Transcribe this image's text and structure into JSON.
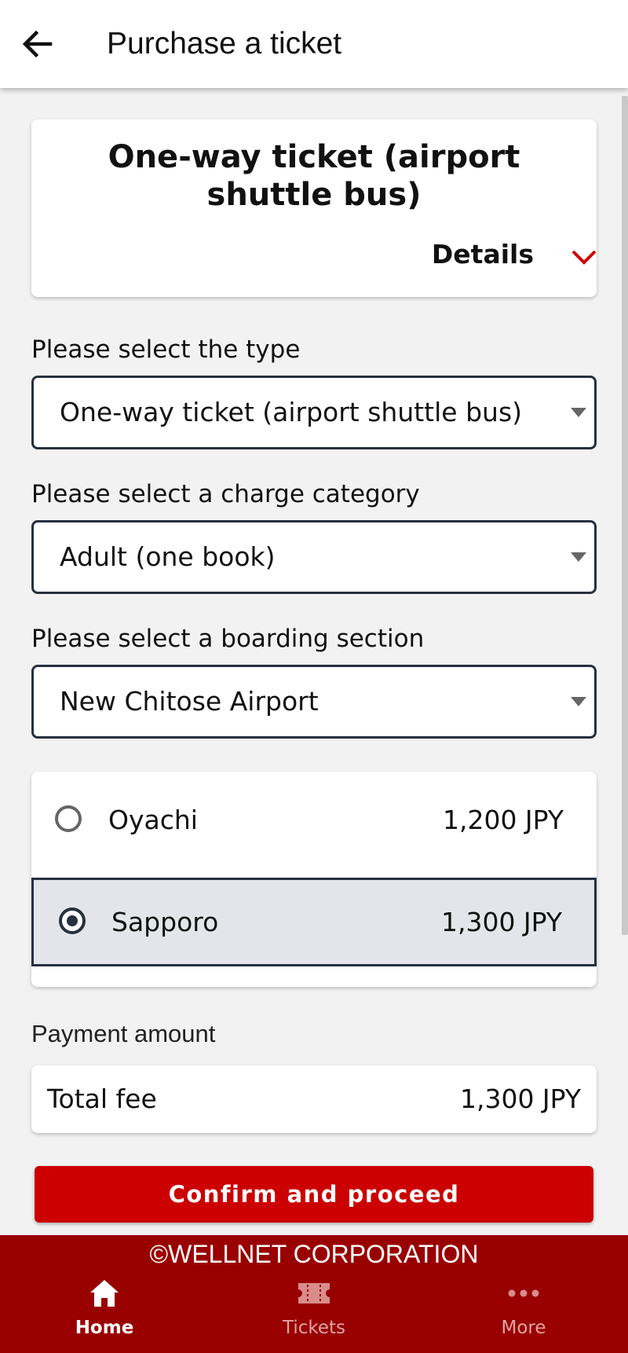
{
  "header": {
    "title": "Purchase a ticket",
    "back_icon": "arrow-left-icon"
  },
  "ticket_card": {
    "title": "One-way ticket (airport shuttle bus)",
    "details_label": "Details",
    "details_icon": "chevron-down-icon"
  },
  "form": {
    "type": {
      "label": "Please select the type",
      "selected": "One-way ticket (airport shuttle bus)"
    },
    "charge_category": {
      "label": "Please select a charge category",
      "selected": "Adult (one book)"
    },
    "boarding_section": {
      "label": "Please select a boarding section",
      "selected": "New Chitose Airport"
    }
  },
  "destinations": [
    {
      "name": "Oyachi",
      "price": "1,200 JPY",
      "selected": false
    },
    {
      "name": "Sapporo",
      "price": "1,300 JPY",
      "selected": true
    }
  ],
  "payment": {
    "section_label": "Payment amount",
    "total_label": "Total fee",
    "total_value": "1,300 JPY"
  },
  "confirm_label": "Confirm and proceed",
  "footer": {
    "copyright": "©WELLNET CORPORATION",
    "nav": [
      {
        "label": "Home",
        "icon": "home-icon",
        "active": true
      },
      {
        "label": "Tickets",
        "icon": "ticket-icon",
        "active": false
      },
      {
        "label": "More",
        "icon": "more-dots-icon",
        "active": false
      }
    ]
  },
  "colors": {
    "accent": "#cc0000",
    "footer_bg": "#990000",
    "border": "#27303f",
    "selected_bg": "#e3e5ea"
  }
}
